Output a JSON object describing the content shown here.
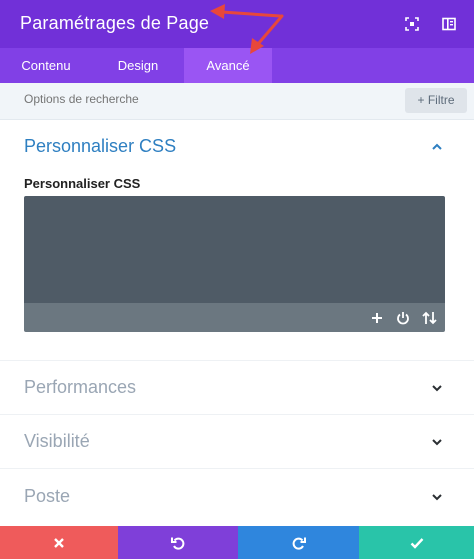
{
  "header": {
    "title": "Paramétrages de Page"
  },
  "tabs": [
    {
      "label": "Contenu"
    },
    {
      "label": "Design"
    },
    {
      "label": "Avancé"
    }
  ],
  "search": {
    "placeholder": "Options de recherche",
    "filter_label": "+ Filtre"
  },
  "sections": [
    {
      "title": "Personnaliser CSS",
      "expanded": true,
      "field_label": "Personnaliser CSS"
    },
    {
      "title": "Performances",
      "expanded": false
    },
    {
      "title": "Visibilité",
      "expanded": false
    },
    {
      "title": "Poste",
      "expanded": false
    }
  ],
  "colors": {
    "header": "#7130d8",
    "tab_bar": "#8140e6",
    "tab_active": "#9a55f3",
    "accent_blue": "#2e7fc1",
    "annotation_arrow": "#e8473b",
    "cancel": "#ef5b5b",
    "undo": "#7f3fd9",
    "redo": "#2f86dd",
    "save": "#29c4a9"
  },
  "icons": [
    "expand-icon",
    "sidebar-toggle-icon",
    "plus-icon",
    "power-icon",
    "sort-arrows-icon",
    "chevron-up-icon",
    "chevron-down-icon",
    "close-icon",
    "undo-icon",
    "redo-icon",
    "check-icon"
  ]
}
